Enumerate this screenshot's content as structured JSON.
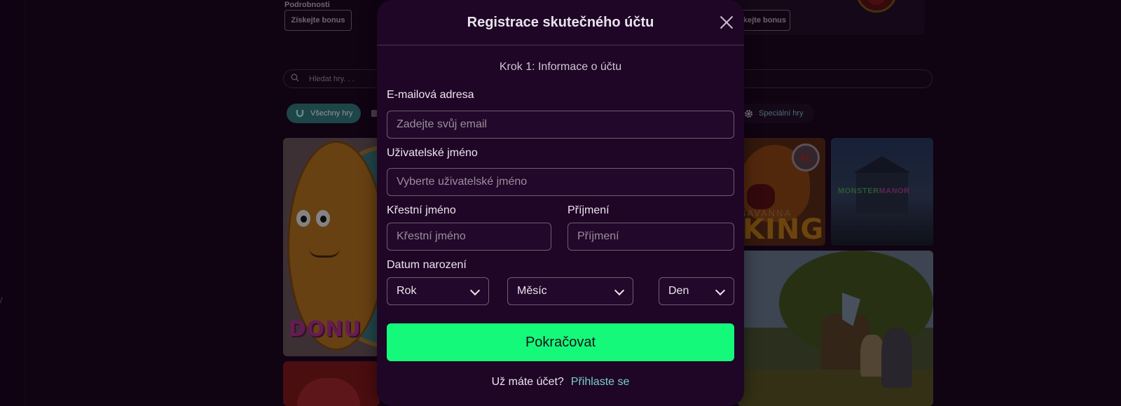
{
  "background": {
    "promo_left": {
      "details_label": "Podrobnosti",
      "bonus_button": "Získejte bonus"
    },
    "promo_right": {
      "bonus_button": "Získejte bonus"
    },
    "search": {
      "placeholder": "Hledat hry. . ."
    },
    "categories": [
      {
        "label": "Všechny hry",
        "icon": "horseshoe-icon",
        "active": true
      },
      {
        "label": "Speciální hry",
        "icon": "gear-icon",
        "active": false
      }
    ],
    "games": [
      {
        "name": "donut",
        "title_text": "DONU"
      },
      {
        "name": "savanna-king",
        "title_small": "SAVANNA",
        "title_big": "KING",
        "badge": "XL"
      },
      {
        "name": "monster-manor",
        "title_part1": "MONSTER",
        "title_part2": "MANOR"
      }
    ],
    "left_mark": "/"
  },
  "modal": {
    "title": "Registrace skutečného účtu",
    "step": "Krok 1: Informace o účtu",
    "email": {
      "label": "E-mailová adresa",
      "placeholder": "Zadejte svůj email",
      "value": ""
    },
    "username": {
      "label": "Uživatelské jméno",
      "placeholder": "Vyberte uživatelské jméno",
      "value": ""
    },
    "first_name": {
      "label": "Křestní jméno",
      "placeholder": "Křestní jméno",
      "value": ""
    },
    "last_name": {
      "label": "Příjmení",
      "placeholder": "Příjmení",
      "value": ""
    },
    "birth_date": {
      "label": "Datum narození",
      "year": "Rok",
      "month": "Měsíc",
      "day": "Den"
    },
    "continue_button": "Pokračovat",
    "login_question": "Už máte účet?",
    "login_link": "Přihlaste se"
  },
  "colors": {
    "page_bg": "#150617",
    "modal_bg": "#1f0526",
    "primary_button": "#14f97a",
    "link": "#78d0cf",
    "active_category": "#2a6b6b"
  }
}
